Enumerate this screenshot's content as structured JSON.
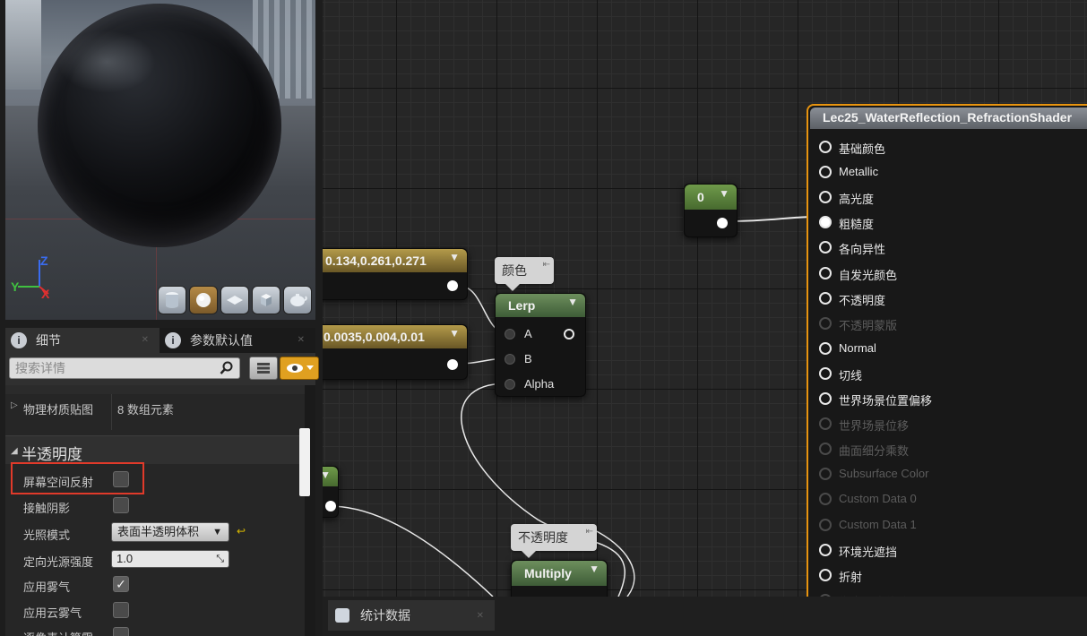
{
  "viewport": {
    "axis_z": "Z",
    "axis_y": "Y",
    "axis_x": "X"
  },
  "tabs": [
    {
      "label": "细节"
    },
    {
      "label": "参数默认值"
    }
  ],
  "search": {
    "placeholder": "搜索详情"
  },
  "details": {
    "partial_row_label": "",
    "phys_map": {
      "label": "物理材质贴图",
      "value": "8 数组元素"
    },
    "section_title": "半透明度",
    "rows": {
      "ssr": "屏幕空间反射",
      "contact_shadow": "接触阴影",
      "lighting_mode": "光照模式",
      "lighting_mode_value": "表面半透明体积",
      "dir_light": "定向光源强度",
      "dir_light_value": "1.0",
      "apply_fog": "应用雾气",
      "apply_cloud_fog": "应用云雾气",
      "cutoff": "逐像素计算雾"
    }
  },
  "graph": {
    "const_node": {
      "label": "0"
    },
    "vec_node_1": {
      "label": "0.134,0.261,0.271"
    },
    "vec_node_2": {
      "label": "0.0035,0.004,0.01"
    },
    "comment_color": "颜色",
    "comment_opacity": "不透明度",
    "lerp": {
      "title": "Lerp",
      "pin_a": "A",
      "pin_b": "B",
      "pin_alpha": "Alpha"
    },
    "multiply": {
      "title": "Multiply"
    },
    "material": {
      "title": "Lec25_WaterReflection_RefractionShader",
      "pins": [
        {
          "label": "基础颜色",
          "enabled": true
        },
        {
          "label": "Metallic",
          "enabled": true
        },
        {
          "label": "高光度",
          "enabled": true
        },
        {
          "label": "粗糙度",
          "enabled": true,
          "connected": true
        },
        {
          "label": "各向异性",
          "enabled": true
        },
        {
          "label": "自发光颜色",
          "enabled": true
        },
        {
          "label": "不透明度",
          "enabled": true
        },
        {
          "label": "不透明蒙版",
          "enabled": false
        },
        {
          "label": "Normal",
          "enabled": true
        },
        {
          "label": "切线",
          "enabled": true
        },
        {
          "label": "世界场景位置偏移",
          "enabled": true
        },
        {
          "label": "世界场景位移",
          "enabled": false
        },
        {
          "label": "曲面细分乘数",
          "enabled": false
        },
        {
          "label": "Subsurface Color",
          "enabled": false
        },
        {
          "label": "Custom Data 0",
          "enabled": false
        },
        {
          "label": "Custom Data 1",
          "enabled": false
        },
        {
          "label": "环境光遮挡",
          "enabled": true
        },
        {
          "label": "折射",
          "enabled": true
        },
        {
          "label": "像素深度偏移",
          "enabled": false
        }
      ]
    }
  },
  "bottom_tab": {
    "label": "统计数据"
  },
  "colors": {
    "accent": "#e8940f",
    "highlight_box": "#e03a2a",
    "const_header": "#5d7d3f",
    "vector_header": "#8a7432",
    "math_header": "#4f6f46"
  }
}
